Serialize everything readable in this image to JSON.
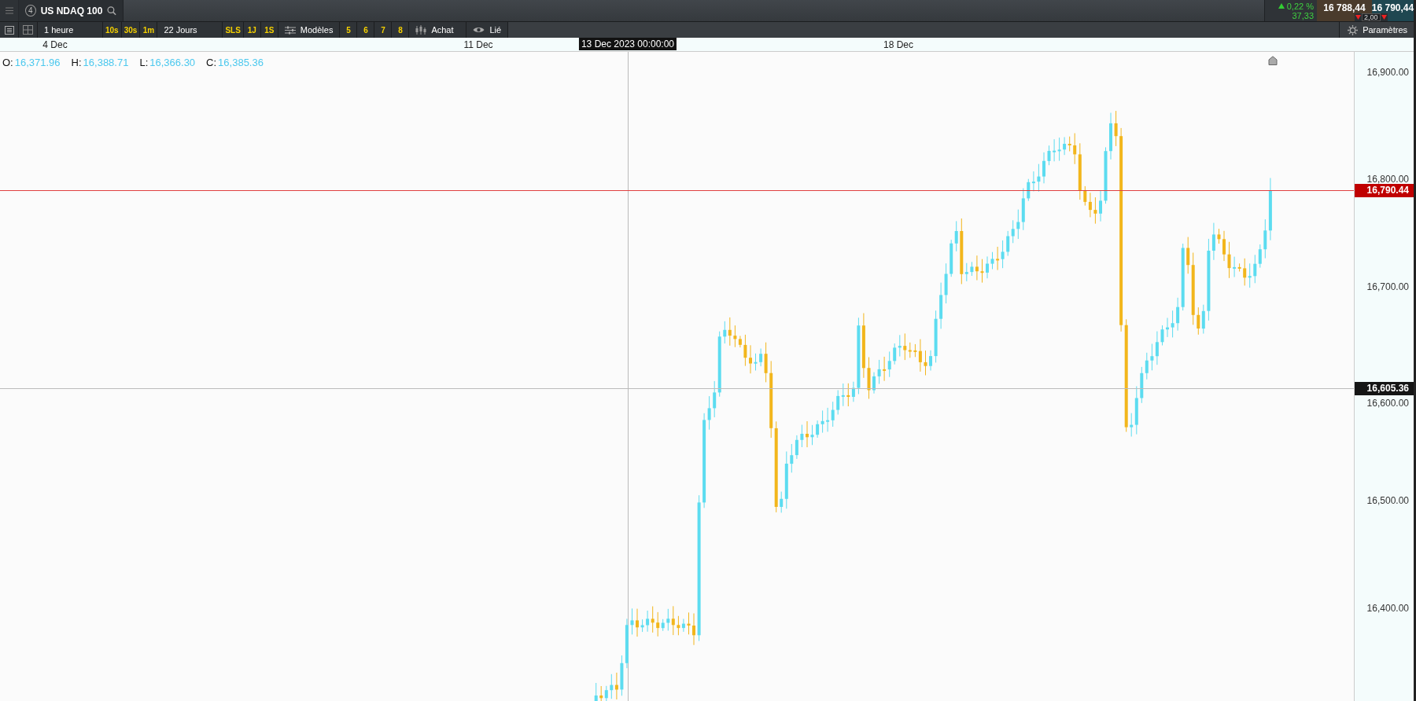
{
  "header": {
    "tab": {
      "number": "4",
      "title": "US NDAQ 100"
    },
    "change": {
      "percent": "0,22 %",
      "points": "37,33"
    },
    "sell": "16 788,44",
    "buy": "16 790,44",
    "spread": "2,00"
  },
  "toolbar": [
    {
      "kind": "text",
      "label": "1 heure"
    },
    {
      "kind": "quick",
      "label": "10s"
    },
    {
      "kind": "quick",
      "label": "30s"
    },
    {
      "kind": "quick",
      "label": "1m"
    },
    {
      "kind": "text",
      "label": "22 Jours"
    },
    {
      "kind": "quick",
      "label": "SLS"
    },
    {
      "kind": "quick",
      "label": "1J"
    },
    {
      "kind": "quick",
      "label": "1S"
    },
    {
      "kind": "templates",
      "label": "Modèles"
    },
    {
      "kind": "quick",
      "label": "5"
    },
    {
      "kind": "quick",
      "label": "6"
    },
    {
      "kind": "quick",
      "label": "7"
    },
    {
      "kind": "quick",
      "label": "8"
    },
    {
      "kind": "buy",
      "label": "Achat"
    },
    {
      "kind": "link",
      "label": "Lié"
    }
  ],
  "settings": "Paramètres",
  "date_axis": [
    {
      "label": "4 Dec",
      "kind": "tick"
    },
    {
      "label": "11 Dec",
      "kind": "tick"
    },
    {
      "label": "13 Dec 2023 00:00:00",
      "kind": "crosshair"
    },
    {
      "label": "18 Dec",
      "kind": "tick"
    }
  ],
  "ohlc": [
    {
      "label": "O:",
      "value": "16,371.96"
    },
    {
      "label": "H:",
      "value": "16,388.71"
    },
    {
      "label": "L:",
      "value": "16,366.30"
    },
    {
      "label": "C:",
      "value": "16,385.36"
    }
  ],
  "price_axis": [
    "16,900.00",
    "16,800.00",
    "16,700.00",
    "16,600.00",
    "16,500.00",
    "16,400.00"
  ],
  "price_lines": [
    {
      "label": "16,790.44",
      "kind": "last"
    },
    {
      "label": "16,605.36",
      "kind": "crosshair"
    }
  ]
}
